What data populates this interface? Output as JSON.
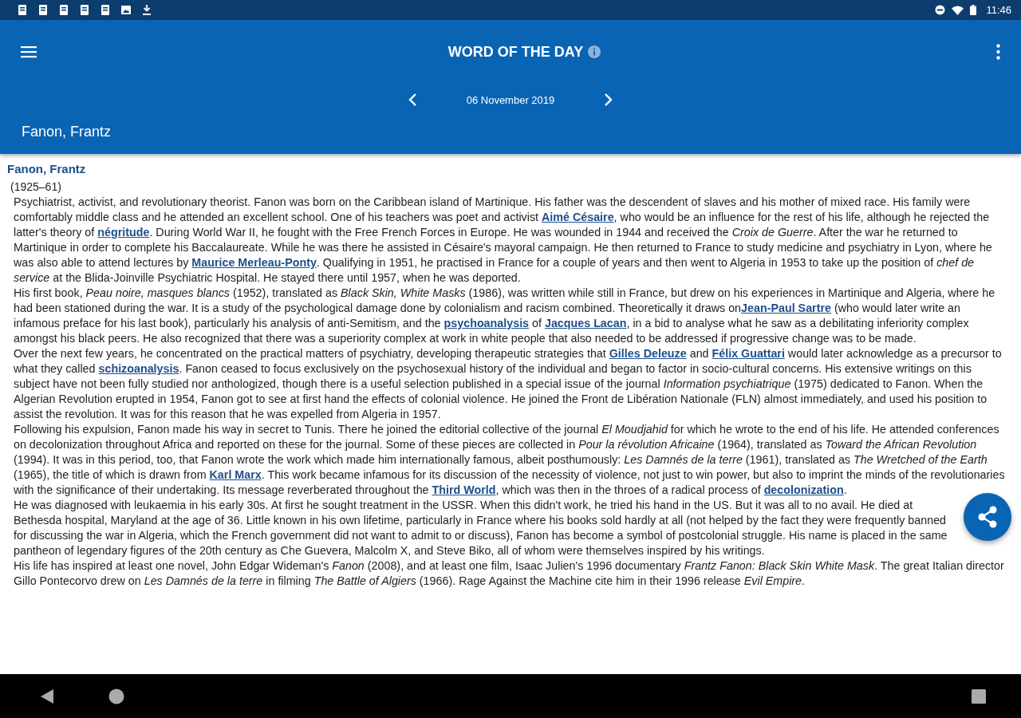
{
  "status_bar": {
    "time": "11:46"
  },
  "app_bar": {
    "title": "WORD OF THE DAY",
    "date": "06 November 2019",
    "headword": "Fanon, Frantz"
  },
  "entry": {
    "headword": "Fanon, Frantz",
    "dates": "(1925–61)",
    "paragraphs": [
      [
        {
          "kind": "text",
          "text": "Psychiatrist, activist, and revolutionary theorist. Fanon was born on the Caribbean island of Martinique. His father was the descendent of slaves and his mother of mixed race. His family were comfortably middle class and he attended an excellent school. One of his teachers was poet and activist "
        },
        {
          "kind": "link",
          "text": "Aimé Césaire"
        },
        {
          "kind": "text",
          "text": ", who would be an influence for the rest of his life, although he rejected the latter's theory of "
        },
        {
          "kind": "link",
          "text": "négritude"
        },
        {
          "kind": "text",
          "text": ". During World War II, he fought with the Free French Forces in Europe. He was wounded in 1944 and received the *Croix de Guerre*. After the war he returned to Martinique in order to complete his Baccalaureate. While he was there he assisted in Césaire's mayoral campaign. He then returned to France to study medicine and psychiatry in Lyon, where he was also able to attend lectures by "
        },
        {
          "kind": "link",
          "text": "Maurice Merleau-Ponty"
        },
        {
          "kind": "text",
          "text": ". Qualifying in 1951, he practised in France for a couple of years and then went to Algeria in 1953 to take up the position of *chef de service* at the Blida-Joinville Psychiatric Hospital. He stayed there until 1957, when he was deported."
        }
      ],
      [
        {
          "kind": "text",
          "text": "His first book, *Peau noire, masques blancs* (1952), translated as *Black Skin, White Masks* (1986), was written while still in France, but drew on his experiences in Martinique and Algeria, where he had been stationed during the war. It is a study of the psychological damage done by colonialism and racism combined. Theoretically it draws on"
        },
        {
          "kind": "link",
          "text": "Jean-Paul Sartre"
        },
        {
          "kind": "text",
          "text": " (who would later write an infamous preface for his last book), particularly his analysis of anti-Semitism, and the "
        },
        {
          "kind": "link",
          "text": "psychoanalysis"
        },
        {
          "kind": "text",
          "text": " of "
        },
        {
          "kind": "link",
          "text": "Jacques Lacan"
        },
        {
          "kind": "text",
          "text": ", in a bid to analyse what he saw as a debilitating inferiority complex amongst his black peers. He also recognized that there was a superiority complex at work in white people that also needed to be addressed if progressive change was to be made."
        }
      ],
      [
        {
          "kind": "text",
          "text": "Over the next few years, he concentrated on the practical matters of psychiatry, developing therapeutic strategies that "
        },
        {
          "kind": "link",
          "text": "Gilles Deleuze"
        },
        {
          "kind": "text",
          "text": " and "
        },
        {
          "kind": "link",
          "text": "Félix Guattari"
        },
        {
          "kind": "text",
          "text": " would later acknowledge as a precursor to what they called "
        },
        {
          "kind": "link",
          "text": "schizoanalysis"
        },
        {
          "kind": "text",
          "text": ". Fanon ceased to focus exclusively on the psychosexual history of the individual and began to factor in socio-cultural concerns. His extensive writings on this subject have not been fully studied nor anthologized, though there is a useful selection published in a special issue of the journal *Information psychiatrique* (1975) dedicated to Fanon. When the Algerian Revolution erupted in 1954, Fanon got to see at first hand the effects of colonial violence. He joined the Front de Libération Nationale (FLN) almost immediately, and used his position to assist the revolution. It was for this reason that he was expelled from Algeria in 1957."
        }
      ],
      [
        {
          "kind": "text",
          "text": "Following his expulsion, Fanon made his way in secret to Tunis. There he joined the editorial collective of the journal *El Moudjahid* for which he wrote to the end of his life. He attended conferences on decolonization throughout Africa and reported on these for the journal. Some of these pieces are collected in *Pour la révolution Africaine* (1964), translated as *Toward the African Revolution* (1994). It was in this period, too, that Fanon wrote the work which made him internationally famous, albeit posthumously: *Les Damnés de la terre* (1961), translated as *The Wretched of the Earth* (1965), the title of which is drawn from "
        },
        {
          "kind": "link",
          "text": "Karl Marx"
        },
        {
          "kind": "text",
          "text": ". This work became infamous for its discussion of the necessity of violence, not just to win power, but also to imprint the minds of the revolutionaries with the significance of their undertaking. Its message reverberated throughout the "
        },
        {
          "kind": "link",
          "text": "Third World"
        },
        {
          "kind": "text",
          "text": ", which was then in the throes of a radical process of "
        },
        {
          "kind": "link",
          "text": "decolonization"
        },
        {
          "kind": "text",
          "text": "."
        }
      ],
      [
        {
          "kind": "text",
          "text": "He was diagnosed with leukaemia in his early 30s. At first he sought treatment in the USSR. When this didn't work, he tried his hand in the US. But it was all to no avail. He died at Bethesda hospital, Maryland at the age of 36. Little known in his own lifetime, particularly in France where his books sold hardly at all (not helped by the fact they were frequently banned for discussing the war in Algeria, which the French government did not want to admit to or discuss), Fanon has become a symbol of postcolonial struggle. His name is placed in the same pantheon of legendary figures of the 20th century as Che Guevera, Malcolm X, and Steve Biko, all of whom were themselves inspired by his writings."
        }
      ],
      [
        {
          "kind": "text",
          "text": "His life has inspired at least one novel, John Edgar Wideman's *Fanon* (2008), and at least one film, Isaac Julien's 1996 documentary *Frantz Fanon: Black Skin White Mask*. The great Italian director Gillo Pontecorvo drew on *Les Damnés de la terre* in filming *The Battle of Algiers* (1966). Rage Against the Machine cite him in their 1996 release *Evil Empire*."
        }
      ]
    ]
  }
}
